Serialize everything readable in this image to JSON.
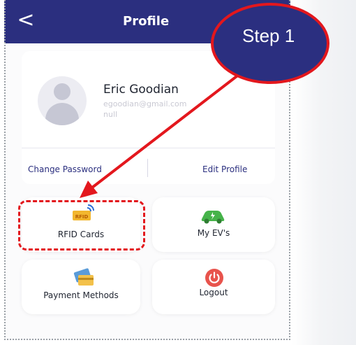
{
  "header": {
    "back_glyph": "<",
    "title": "Profile"
  },
  "profile": {
    "name": "Eric Goodian",
    "email": "egoodian@gmail.com",
    "phone": "null",
    "change_password_label": "Change Password",
    "edit_profile_label": "Edit Profile"
  },
  "menu": {
    "rfid_label": "RFID Cards",
    "rfid_badge": "RFID",
    "ev_label": "My EV's",
    "payment_label": "Payment Methods",
    "logout_label": "Logout"
  },
  "annotation": {
    "step_label": "Step 1",
    "color": "#e3171d"
  },
  "theme": {
    "header_color": "#2b2f7f",
    "bubble_color": "#2b2f80",
    "accent_red": "#e3171d"
  }
}
